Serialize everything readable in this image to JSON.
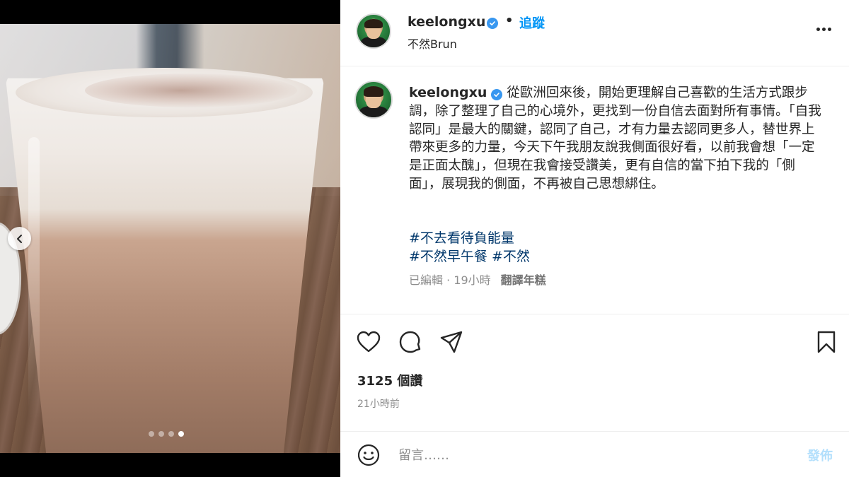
{
  "post": {
    "username": "keelongxu",
    "separator": "•",
    "follow_label": "追蹤",
    "location": "不然Brun",
    "caption_text": "從歐洲回來後，開始更理解自己喜歡的生活方式跟步調，除了整理了自己的心境外，更找到一份自信去面對所有事情。「自我認同」是最大的關鍵，認同了自己，才有力量去認同更多人，替世界上帶來更多的力量，今天下午我朋友說我側面很好看，以前我會想「一定是正面太醜」，但現在我會接受讚美，更有自信的當下拍下我的「側面」，展現我的側面，不再被自己思想綁住。",
    "hashtags": {
      "line1": "#不去看待負能量",
      "line2_a": "#不然早午餐",
      "line2_b": "#不然"
    },
    "meta": {
      "edited_time": "已編輯 · 19小時",
      "translate_label": "翻譯年糕"
    },
    "likes": "3125 個讚",
    "time_ago": "21小時前"
  },
  "carousel": {
    "slide_count": 4,
    "active_index": 3
  },
  "comment": {
    "placeholder": "留言……",
    "post_label": "發佈"
  },
  "colors": {
    "accent_blue": "#0095f6",
    "hashtag": "#00376b",
    "verified": "#3897f0",
    "muted": "#8e8e8e",
    "post_disabled": "#b2dffc"
  },
  "icons": {
    "verified": "verified-badge-icon",
    "more": "more-options-icon",
    "like": "heart-icon",
    "comment": "comment-bubble-icon",
    "share": "paper-plane-icon",
    "save": "bookmark-icon",
    "emoji": "emoji-smiley-icon",
    "prev": "chevron-left-icon"
  }
}
